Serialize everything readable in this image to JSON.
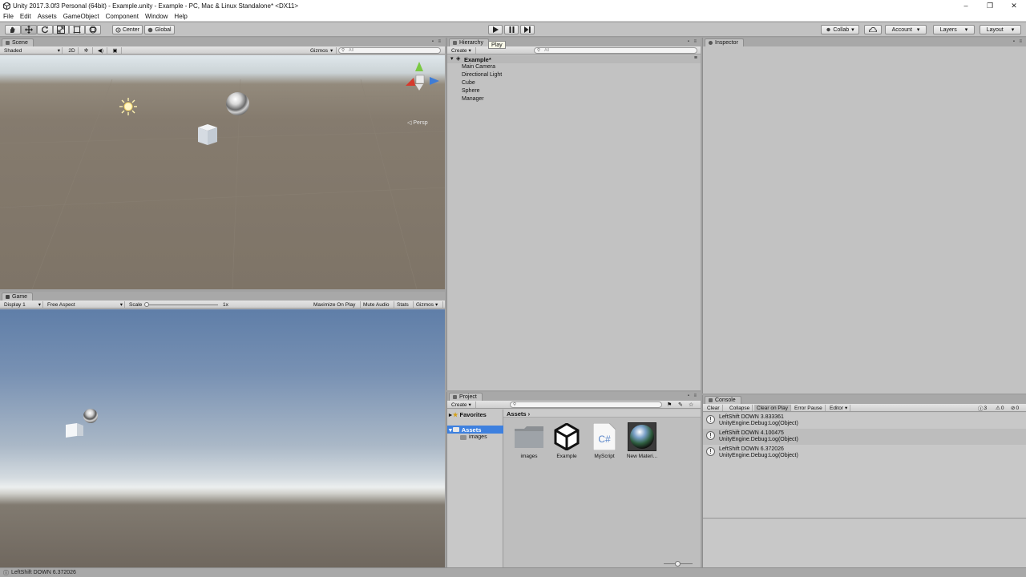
{
  "window": {
    "title": "Unity 2017.3.0f3 Personal (64bit) - Example.unity - Example - PC, Mac & Linux Standalone* <DX11>",
    "minimize": "–",
    "restore": "❐",
    "close": "✕"
  },
  "menubar": [
    "File",
    "Edit",
    "Assets",
    "GameObject",
    "Component",
    "Window",
    "Help"
  ],
  "toolbar": {
    "pivot_label": "Center",
    "space_label": "Global",
    "play_tooltip": "Play",
    "collab_label": "Collab",
    "account_label": "Account",
    "layers_label": "Layers",
    "layout_label": "Layout"
  },
  "scene": {
    "tab": "Scene",
    "shading_mode": "Shaded",
    "mode_2d": "2D",
    "gizmos_label": "Gizmos",
    "search_placeholder": "All",
    "persp_label": "Persp"
  },
  "game": {
    "tab": "Game",
    "display": "Display 1",
    "aspect": "Free Aspect",
    "scale_label": "Scale",
    "scale_value": "1x",
    "maximize_on_play": "Maximize On Play",
    "mute_audio": "Mute Audio",
    "stats": "Stats",
    "gizmos_label": "Gizmos"
  },
  "hierarchy": {
    "tab": "Hierarchy",
    "create_label": "Create",
    "search_placeholder": "All",
    "scene_name": "Example*",
    "items": [
      "Main Camera",
      "Directional Light",
      "Cube",
      "Sphere",
      "Manager"
    ]
  },
  "inspector": {
    "tab": "Inspector"
  },
  "project": {
    "tab": "Project",
    "create_label": "Create",
    "favorites_label": "Favorites",
    "assets_label": "Assets",
    "folder_images": "images",
    "breadcrumb": "Assets ›",
    "assets": [
      {
        "name": "images",
        "icon": "folder-icon"
      },
      {
        "name": "Example",
        "icon": "unity-scene-icon"
      },
      {
        "name": "MyScript",
        "icon": "csharp-script-icon"
      },
      {
        "name": "New Materi...",
        "icon": "material-sphere-icon"
      }
    ]
  },
  "console": {
    "tab": "Console",
    "clear": "Clear",
    "collapse": "Collapse",
    "clear_on_play": "Clear on Play",
    "error_pause": "Error Pause",
    "editor": "Editor",
    "count_info": "3",
    "count_warn": "0",
    "count_error": "0",
    "logs": [
      {
        "line1": "LeftShift DOWN 3.833361",
        "line2": "UnityEngine.Debug:Log(Object)"
      },
      {
        "line1": "LeftShift DOWN 4.100475",
        "line2": "UnityEngine.Debug:Log(Object)"
      },
      {
        "line1": "LeftShift DOWN 6.372026",
        "line2": "UnityEngine.Debug:Log(Object)"
      }
    ]
  },
  "statusbar": {
    "text": "LeftShift DOWN 6.372026"
  },
  "colors": {
    "accent_selection": "#3d80df",
    "panel_bg": "#c2c2c2"
  }
}
